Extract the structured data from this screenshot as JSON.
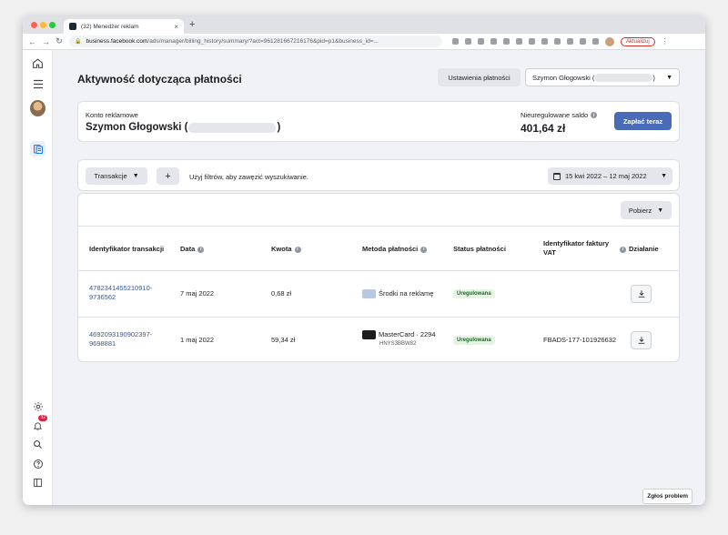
{
  "browser": {
    "tab_title": "(32) Menedżer reklam",
    "tab_close": "×",
    "new_tab": "+",
    "url_host": "business.facebook.com",
    "url_path": "/ads/manager/billing_history/summary/?act=961281667216176&pid=p1&business_id=...",
    "update_label": "Aktualizuj"
  },
  "header": {
    "title": "Aktywność dotycząca płatności",
    "settings_label": "Ustawienia płatności",
    "account_select_name": "Szymon Głogowski (",
    "account_select_suffix": ")"
  },
  "account": {
    "label": "Konto reklamowe",
    "name": "Szymon Głogowski (",
    "name_suffix": ")",
    "balance_label": "Nieuregulowane saldo",
    "balance_value": "401,64 zł",
    "pay_label": "Zapłać teraz"
  },
  "filters": {
    "transactions_label": "Transakcje",
    "add_label": "+",
    "hint": "Użyj filtrów, aby zawęzić wyszukiwanie.",
    "date_range": "15 kwi 2022 – 12 maj 2022"
  },
  "table": {
    "download_label": "Pobierz",
    "columns": {
      "id": "Identyfikator transakcji",
      "date": "Data",
      "amount": "Kwota",
      "method": "Metoda płatności",
      "status": "Status płatności",
      "vat": "Identyfikator faktury VAT",
      "action": "Działanie"
    },
    "rows": [
      {
        "id_line1": "4782341455210910-",
        "id_line2": "9736562",
        "date": "7 maj 2022",
        "amount": "0,68 zł",
        "method": "Środki na reklamę",
        "method_sub": "",
        "status": "Uregulowana",
        "vat": ""
      },
      {
        "id_line1": "4692093190902397-",
        "id_line2": "9698881",
        "date": "1 maj 2022",
        "amount": "59,34 zł",
        "method": "MasterCard · 2294",
        "method_sub": "HNYS3BBW82",
        "status": "Uregulowana",
        "vat": "FBADS-177-101926632"
      }
    ]
  },
  "footer": {
    "report_label": "Zgłoś problem"
  },
  "rail": {
    "notifications_count": "32"
  },
  "colors": {
    "accent": "#4a6bb7",
    "link": "#385898",
    "status_bg": "#e5f4e3",
    "status_text": "#1d6b2a"
  }
}
